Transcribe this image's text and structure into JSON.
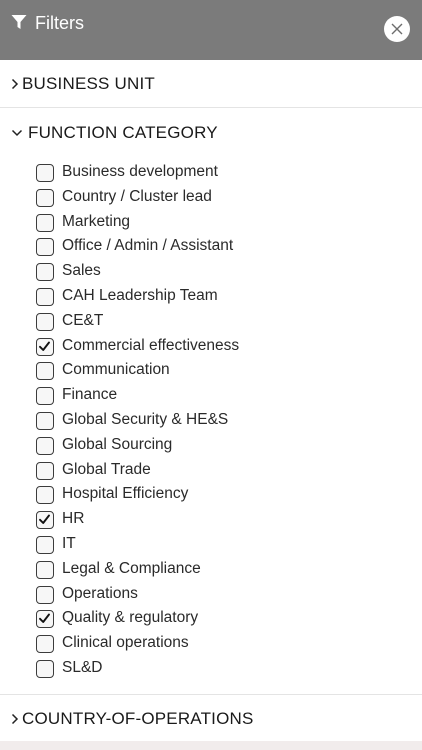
{
  "header": {
    "title": "Filters",
    "close_label": "close"
  },
  "sections": {
    "business_unit": "BUSINESS UNIT",
    "function_category": "FUNCTION CATEGORY",
    "country_of_operations": "COUNTRY-OF-OPERATIONS"
  },
  "function_options": [
    {
      "label": "Business development",
      "checked": false
    },
    {
      "label": "Country / Cluster lead",
      "checked": false
    },
    {
      "label": "Marketing",
      "checked": false
    },
    {
      "label": "Office / Admin / Assistant",
      "checked": false
    },
    {
      "label": "Sales",
      "checked": false
    },
    {
      "label": "CAH Leadership Team",
      "checked": false
    },
    {
      "label": "CE&T",
      "checked": false
    },
    {
      "label": "Commercial effectiveness",
      "checked": true
    },
    {
      "label": "Communication",
      "checked": false
    },
    {
      "label": "Finance",
      "checked": false
    },
    {
      "label": "Global Security & HE&S",
      "checked": false
    },
    {
      "label": "Global Sourcing",
      "checked": false
    },
    {
      "label": "Global Trade",
      "checked": false
    },
    {
      "label": "Hospital Efficiency",
      "checked": false
    },
    {
      "label": "HR",
      "checked": true
    },
    {
      "label": "IT",
      "checked": false
    },
    {
      "label": "Legal & Compliance",
      "checked": false
    },
    {
      "label": "Operations",
      "checked": false
    },
    {
      "label": "Quality & regulatory",
      "checked": true
    },
    {
      "label": "Clinical operations",
      "checked": false
    },
    {
      "label": "SL&D",
      "checked": false
    }
  ],
  "icons": {
    "filter": "filter-icon",
    "close": "close-icon",
    "chevron_right": "chevron-right-icon",
    "chevron_down": "chevron-down-icon",
    "check": "checkmark-icon"
  },
  "colors": {
    "header_bg": "#7b7b7b",
    "header_text": "#ffffff"
  }
}
